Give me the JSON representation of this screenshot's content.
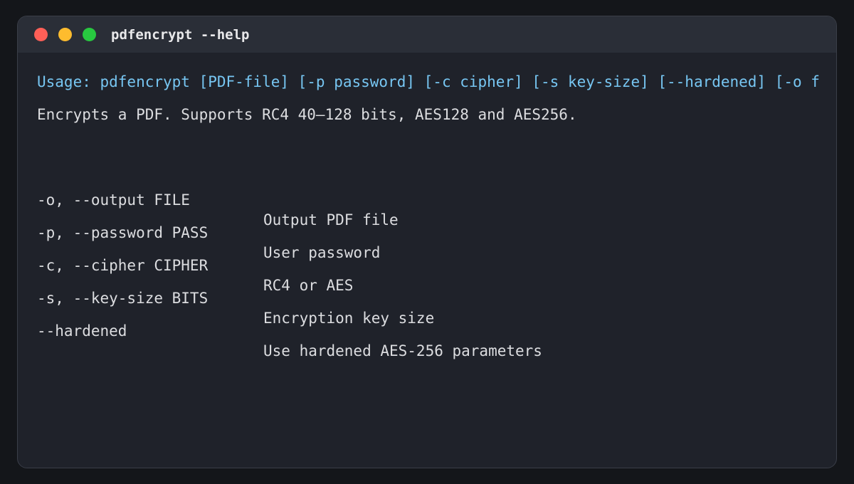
{
  "window": {
    "title": "pdfencrypt --help"
  },
  "colors": {
    "background": "#14161a",
    "terminal_bg": "#1f222a",
    "title_bar_bg": "#2a2e37",
    "usage_text": "#77c6f2",
    "body_text": "#dcdde0",
    "close": "#fe5f57",
    "minimize": "#febc2e",
    "maximize": "#28c840"
  },
  "output": {
    "usage": "Usage: pdfencrypt [PDF-file] [-p password] [-c cipher] [-s key-size] [--hardened] [-o f",
    "description": "Encrypts a PDF. Supports RC4 40–128 bits, AES128 and AES256.",
    "options": [
      {
        "flag": "-o, --output FILE",
        "description": "Output PDF file"
      },
      {
        "flag": "-p, --password PASS",
        "description": "User password"
      },
      {
        "flag": "-c, --cipher CIPHER",
        "description": "RC4 or AES"
      },
      {
        "flag": "-s, --key-size BITS",
        "description": "Encryption key size"
      },
      {
        "flag": "--hardened",
        "description": "Use hardened AES-256 parameters"
      }
    ]
  }
}
